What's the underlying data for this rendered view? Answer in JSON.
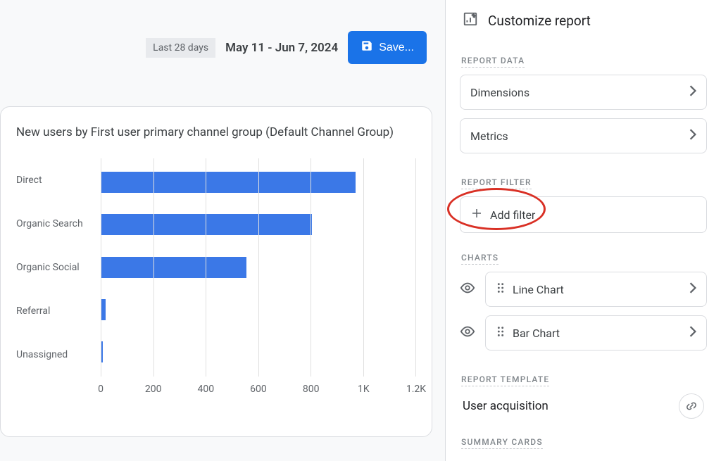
{
  "header": {
    "period_label": "Last 28 days",
    "date_range": "May 11 - Jun 7, 2024",
    "save_label": "Save..."
  },
  "chart_data": {
    "type": "bar",
    "orientation": "horizontal",
    "title": "New users by First user primary channel group (Default Channel Group)",
    "categories": [
      "Direct",
      "Organic Search",
      "Organic Social",
      "Referral",
      "Unassigned"
    ],
    "values": [
      1050,
      870,
      600,
      20,
      10
    ],
    "xlabel": "",
    "ylabel": "",
    "xticks": [
      0,
      200,
      400,
      600,
      800,
      "1K",
      "1.2K"
    ],
    "xlim": [
      0,
      1300
    ],
    "bar_color": "#3b78e7"
  },
  "panel": {
    "title": "Customize report",
    "report_data_label": "REPORT DATA",
    "dimensions_label": "Dimensions",
    "metrics_label": "Metrics",
    "report_filter_label": "REPORT FILTER",
    "add_filter_label": "Add filter",
    "charts_label": "CHARTS",
    "line_chart_label": "Line Chart",
    "bar_chart_label": "Bar Chart",
    "report_template_label": "REPORT TEMPLATE",
    "template_name": "User acquisition",
    "summary_cards_label": "SUMMARY CARDS"
  }
}
